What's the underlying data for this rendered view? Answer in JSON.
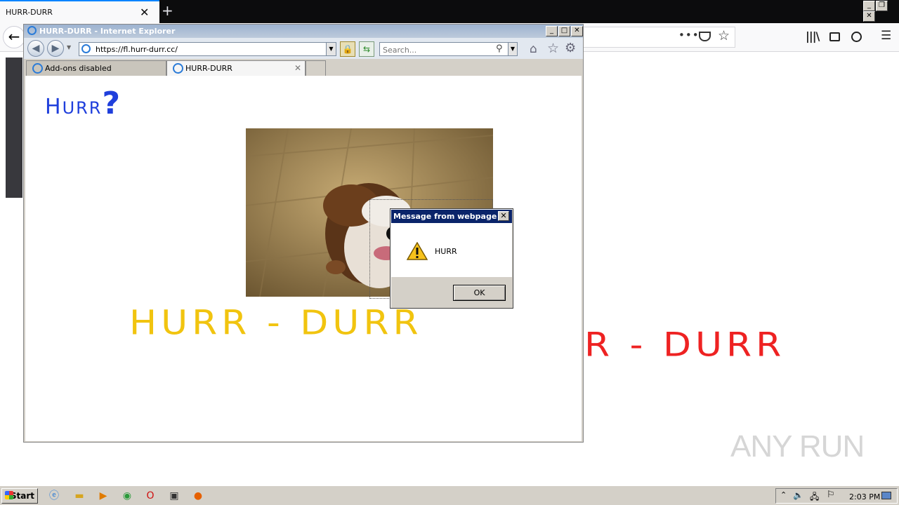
{
  "firefox": {
    "tab_title": "HURR-DURR",
    "close_glyph": "✕",
    "new_tab_glyph": "+",
    "back_glyph": "←",
    "more_glyph": "•••",
    "star_glyph": "☆",
    "library_glyph": "|||\\",
    "menu_glyph": "☰",
    "background_text": "R - DURR"
  },
  "ie": {
    "title": "HURR-DURR - Internet Explorer",
    "address_url": "https://fl.hurr-durr.cc/",
    "search_placeholder": "Search...",
    "tabs": [
      {
        "label": "Add-ons disabled"
      },
      {
        "label": "HURR-DURR"
      }
    ],
    "tab_close_glyph": "✕"
  },
  "page": {
    "heading_part1": "H",
    "heading_part2": "URR",
    "heading_part3": "?",
    "banner_text": "HURR - DURR"
  },
  "dialog": {
    "title": "Message from webpage",
    "message": "HURR",
    "ok_label": "OK",
    "close_glyph": "✕"
  },
  "taskbar": {
    "start_label": "Start",
    "clock": "2:03 PM"
  },
  "watermark": "ANY RUN",
  "colors": {
    "heading": "#1f3fdc",
    "banner": "#f1c40f",
    "background_banner": "#ee2222",
    "dialog_titlebar": "#0a246a"
  }
}
